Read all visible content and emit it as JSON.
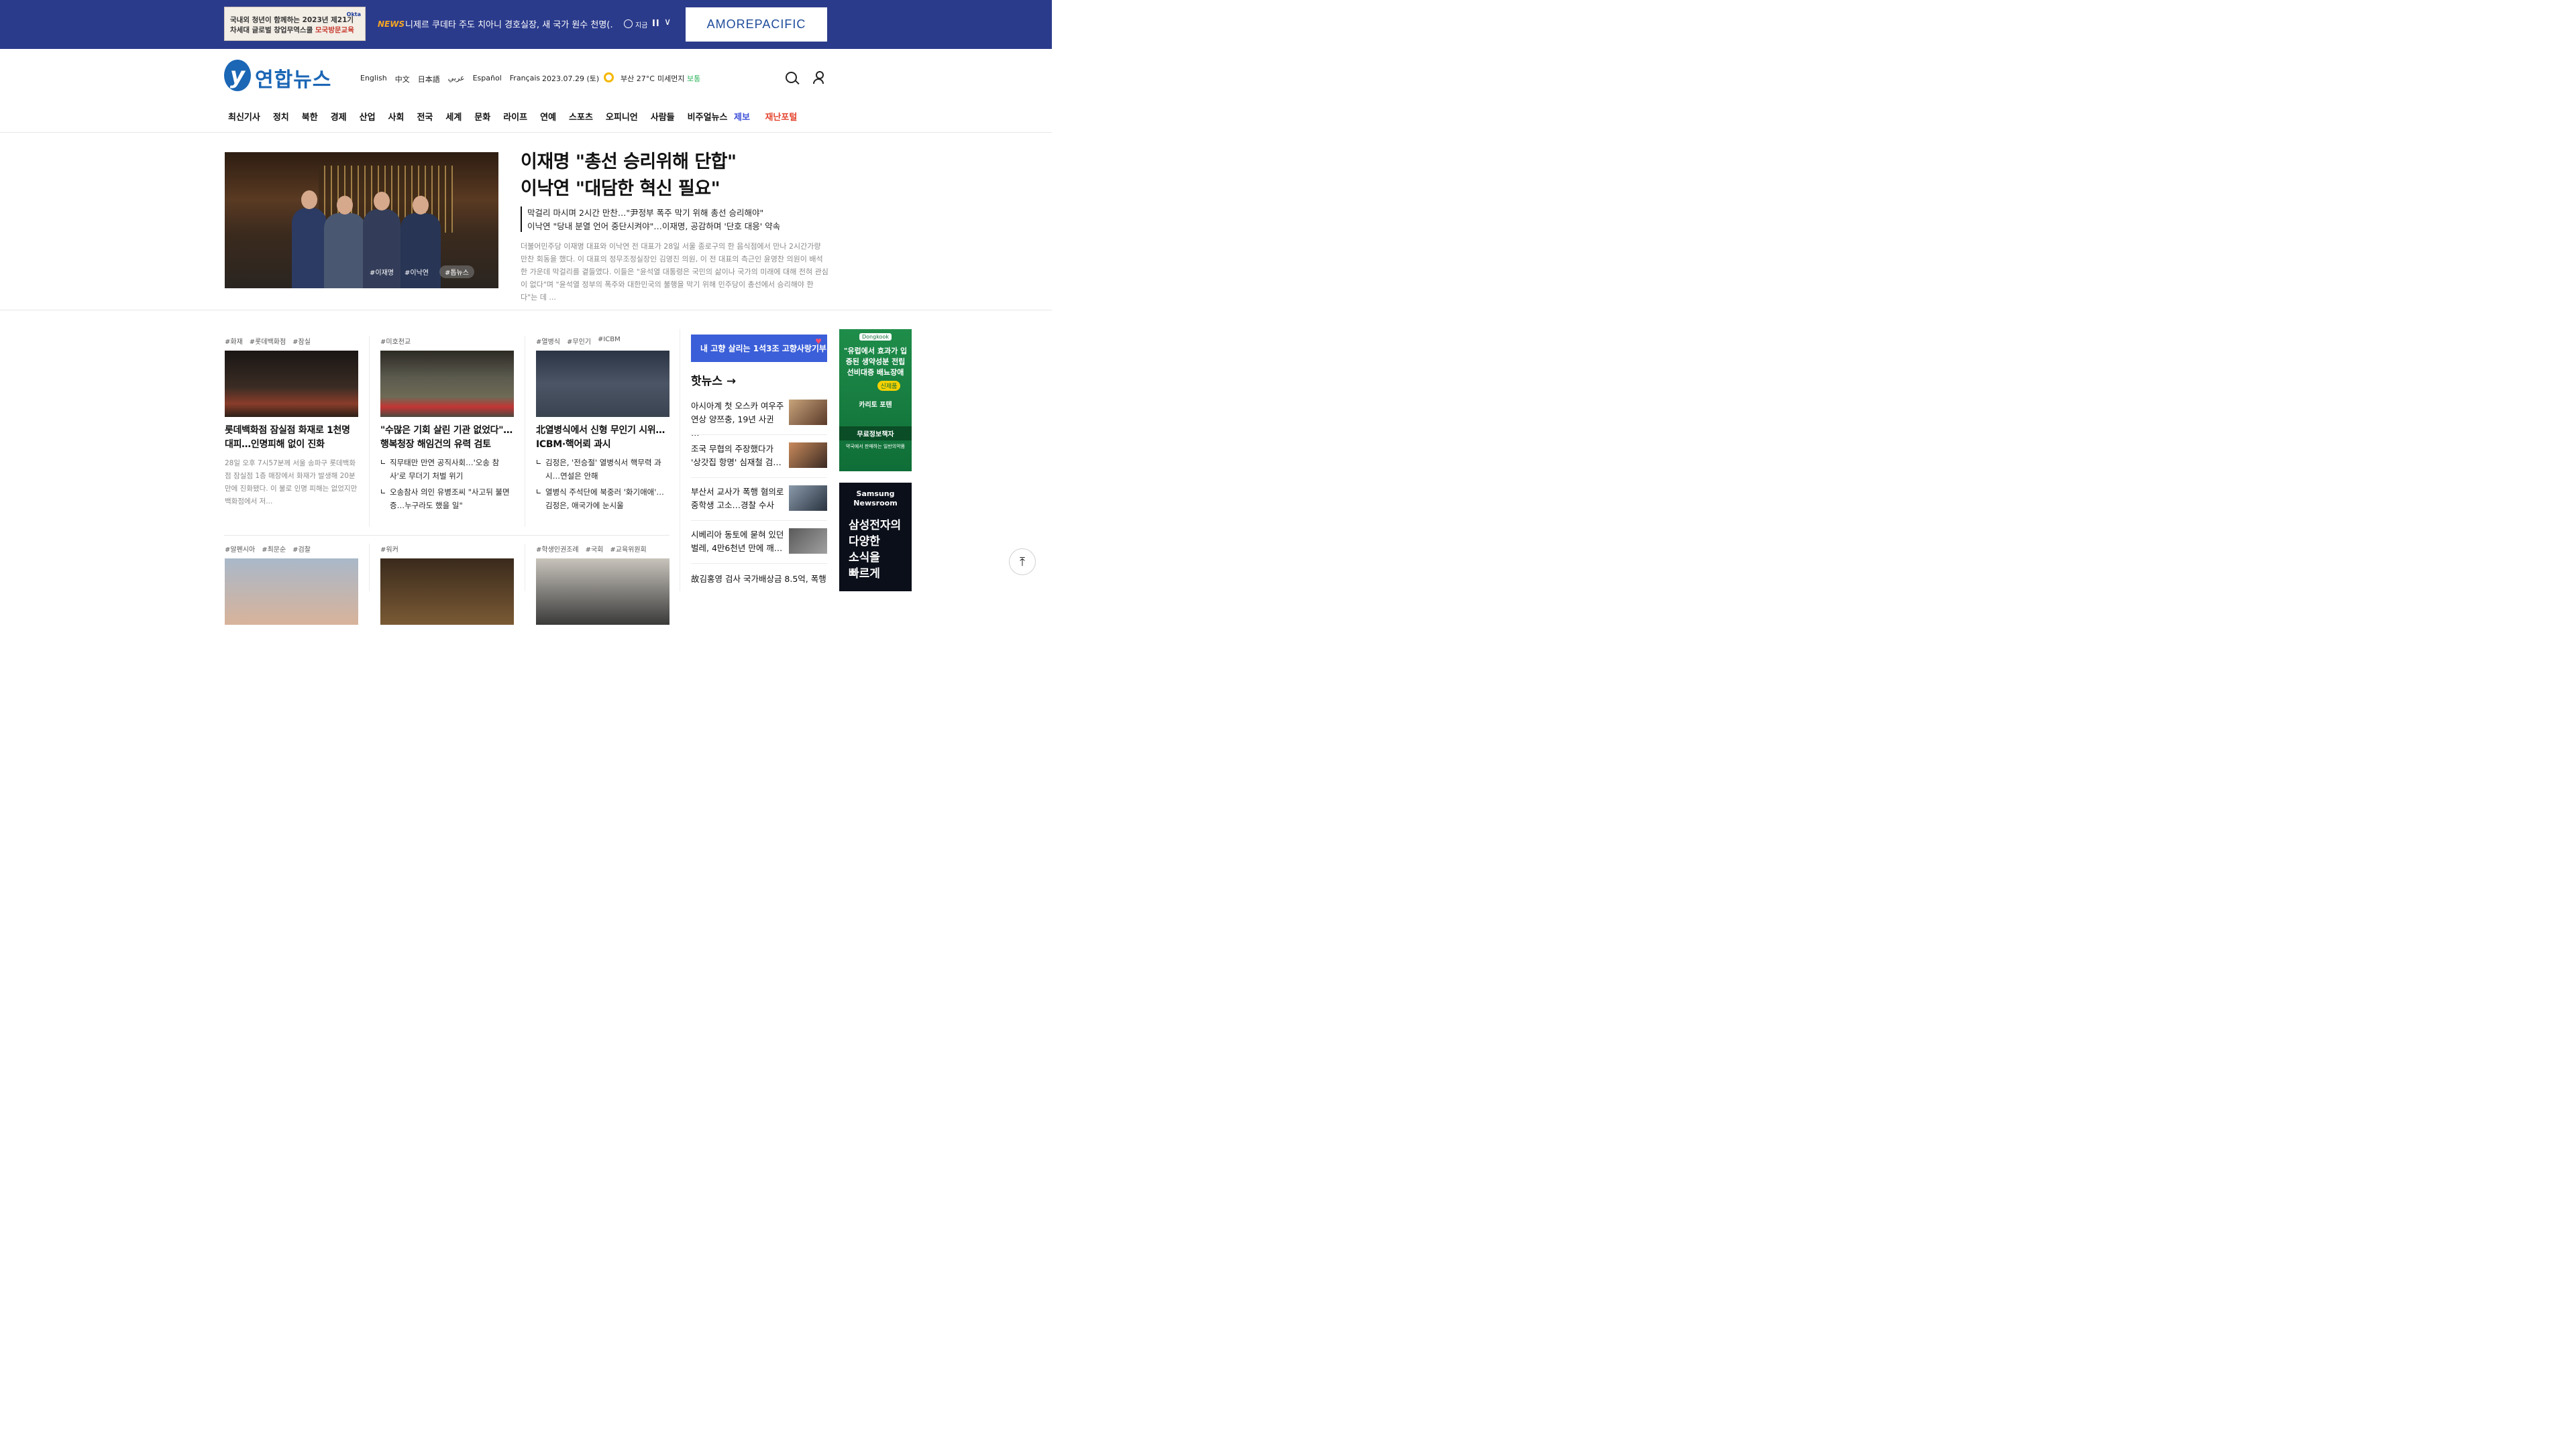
{
  "top_banner": {
    "ad_left": {
      "brand": "Okta",
      "line1": "국내외 청년이 함께하는 2023년 제21기",
      "line2_pre": "차세대 글로벌 창업무역스쿨 ",
      "line2_hl": "모국방문교육"
    },
    "news_tag": "NEWS",
    "ticker": "니제르 쿠데타 주도 치아니 경호실장, 새 국가 원수 천명(…",
    "now_label": "지금",
    "pause_glyph": "II",
    "chevron": "∨",
    "ad_right": "AMOREPACIFIC"
  },
  "header": {
    "logo_mark": "y",
    "logo_text": "연합뉴스",
    "languages": [
      "English",
      "中文",
      "日本語",
      "عربي",
      "Español",
      "Français"
    ],
    "date": "2023.07.29 (토)",
    "weather": "부산 27°C",
    "dust_label": "미세먼지 ",
    "dust_value": "보통"
  },
  "gnb": {
    "items": [
      "최신기사",
      "정치",
      "북한",
      "경제",
      "산업",
      "사회",
      "전국",
      "세계",
      "문화",
      "라이프",
      "연예",
      "스포츠",
      "오피니언",
      "사람들",
      "비주얼뉴스"
    ],
    "tip": "제보",
    "disaster": "재난포털"
  },
  "top_story": {
    "photo_tags": [
      "#이재명",
      "#이낙연",
      "#톱뉴스"
    ],
    "headline_1": "이재명 \"총선 승리위해 단합\"",
    "headline_2": "이낙연 \"대담한 혁신 필요\"",
    "sub_1": "막걸리 마시며 2시간 만찬…\"尹정부 폭주 막기 위해 총선 승리해야\"",
    "sub_2": "이낙연 \"당내 분열 언어 중단시켜야\"…이재명, 공감하며 '단호 대응' 약속",
    "desc": "더불어민주당 이재명 대표와 이낙연 전 대표가 28일 서울 종로구의 한 음식점에서 만나 2시간가량 만찬 회동을 했다. 이 대표의 정무조정실장인 김영진 의원, 이 전 대표의 측근인 윤영찬 의원이 배석한 가운데 막걸리를 곁들였다. 이들은 \"윤석열 대통령은 국민의 삶이나 국가의 미래에 대해 전혀 관심이 없다\"며 \"윤석열 정부의 폭주와 대한민국의 불행을 막기 위해 민주당이 총선에서 승리해야 한다\"는 데 ..."
  },
  "columns": [
    {
      "tags": [
        "#화재",
        "#롯데백화점",
        "#잠실"
      ],
      "title": "롯데백화점 잠실점 화재로 1천명 대피…인명피해 없이 진화",
      "desc": "28일 오후 7시57분께 서울 송파구 롯데백화점 잠실점 1층 매장에서 화재가 발생해 20분 만에 진화됐다. 이 불로 인명 피해는 없었지만 백화점에서 저...",
      "related": []
    },
    {
      "tags": [
        "#미호천교"
      ],
      "title": "\"수많은 기회 살린 기관 없었다\"…행복청장 해임건의 유력 검토",
      "desc": "",
      "related": [
        "직무태만 만연 공직사회…'오송 참사'로 무더기 처벌 위기",
        "오송참사 의인 유병조씨 \"사고뒤 불면증…누구라도 했을 일\""
      ]
    },
    {
      "tags": [
        "#열병식",
        "#무인기",
        "#ICBM"
      ],
      "title": "北열병식에서 신형 무인기 시위…ICBM·핵어뢰 과시",
      "desc": "",
      "related": [
        "김정은, '전승절' 열병식서 핵무력 과시…연설은 안해",
        "열병식 주석단에 북중러 '화기애애'…김정은, 애국가에 눈시울"
      ]
    }
  ],
  "columns_row2_tags": [
    [
      "#알펜시아",
      "#최문순",
      "#검찰"
    ],
    [
      "#워커"
    ],
    [
      "#학생인권조례",
      "#국회",
      "#교육위원회"
    ]
  ],
  "sidebar": {
    "banner": "내 고향 살리는 1석3조 고향사랑기부",
    "hot_title": "핫뉴스 →",
    "hot_items": [
      "아시아계 첫 오스카 여우주연상 양쯔충, 19년 사귄 …",
      "조국 무협의 주장했다가 '상갓집 항명' 심재철 검…",
      "부산서 교사가 폭행 혐의로 중학생 고소…경찰 수사",
      "시베리아 동토에 묻혀 있던 벌레, 4만6천년 만에 깨…",
      "故김홍영 검사 국가배상금 8.5억, 폭행"
    ]
  },
  "ads": {
    "vert1_brand": "Dongkook",
    "vert1_text": "\"유럽에서 효과가 입증된 생약성분 전립선비대증 배뇨장애",
    "vert1_badge": "신제품",
    "vert1_product": "카리토 포텐",
    "vert1_cta": "무료정보책자",
    "vert1_small": "약국에서 판매하는 일반의약품",
    "vert2_brand": "Samsung Newsroom",
    "vert2_l1": "삼성전자의",
    "vert2_l2": "다양한",
    "vert2_l3": "소식을",
    "vert2_l4": "빠르게"
  },
  "scroll_top": "⤒"
}
